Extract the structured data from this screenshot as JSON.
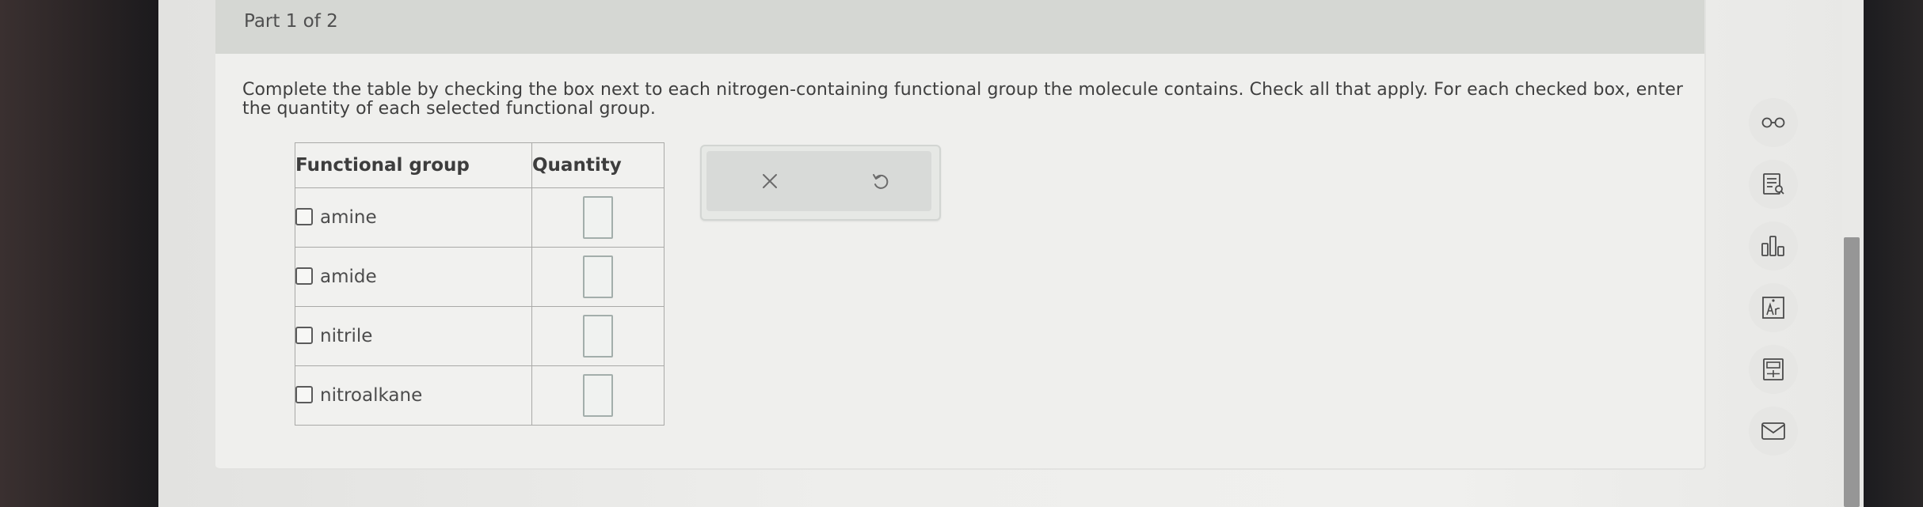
{
  "header": {
    "part_label": "Part 1 of 2"
  },
  "question": {
    "instructions": "Complete the table by checking the box next to each nitrogen-containing functional group the molecule contains. Check all that apply. For each checked box, enter the quantity of each selected functional group."
  },
  "table": {
    "columns": [
      "Functional group",
      "Quantity"
    ],
    "rows": [
      {
        "label": "amine",
        "checked": false,
        "quantity": ""
      },
      {
        "label": "amide",
        "checked": false,
        "quantity": ""
      },
      {
        "label": "nitrile",
        "checked": false,
        "quantity": ""
      },
      {
        "label": "nitroalkane",
        "checked": false,
        "quantity": ""
      }
    ]
  },
  "actions": {
    "clear_icon": "close-icon",
    "undo_icon": "undo-icon"
  },
  "toolbar": {
    "icons": [
      "glasses-icon",
      "notes-icon",
      "bar-chart-icon",
      "periodic-table-icon",
      "calculator-icon",
      "mail-icon"
    ]
  },
  "colors": {
    "header_bg": "#d5d7d3",
    "panel_bg": "#efefed",
    "input_border": "#a3aeab"
  }
}
